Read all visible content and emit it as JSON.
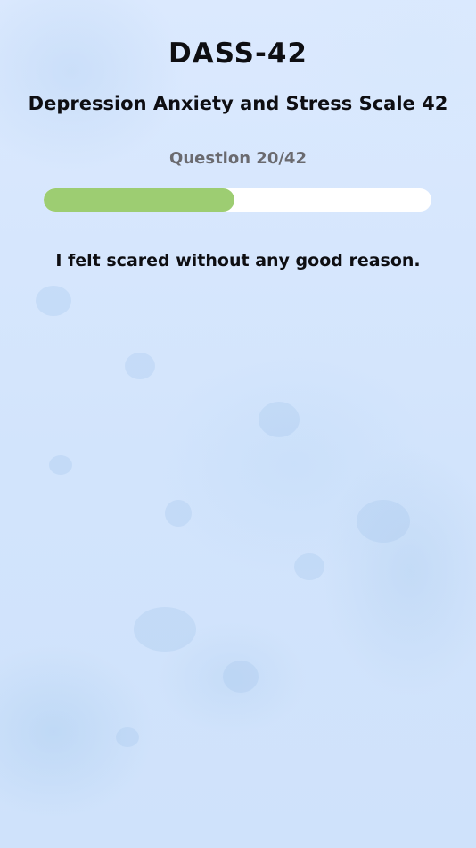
{
  "header": {
    "title": "DASS-42",
    "subtitle": "Depression Anxiety and Stress Scale 42"
  },
  "progress": {
    "label": "Question 20/42",
    "current": 20,
    "total": 42,
    "fraction": 0.493,
    "fill_color": "#9dcd72",
    "track_color": "#ffffff"
  },
  "question": {
    "text": "I felt scared without any good reason."
  },
  "theme": {
    "background": "#d5e6fd",
    "text_color": "#0e0e12",
    "muted_text_color": "#6a6a6f"
  }
}
